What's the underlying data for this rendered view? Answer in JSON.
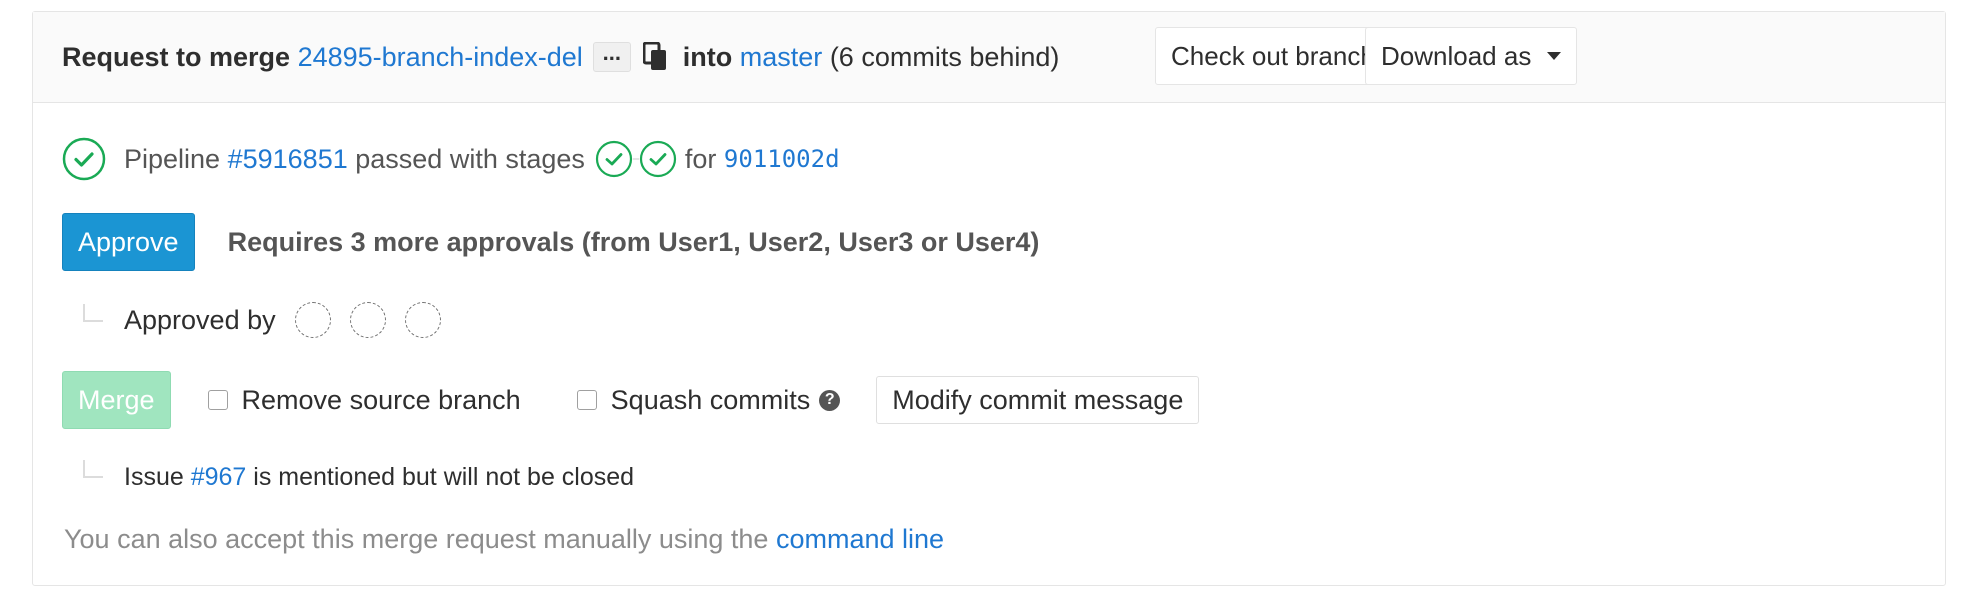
{
  "header": {
    "prefix": "Request to merge",
    "source_branch": "24895-branch-index-del",
    "ellipsis": "...",
    "into": "into",
    "target_branch": "master",
    "behind": "(6 commits behind)",
    "checkout_label": "Check out branch",
    "download_label": "Download as"
  },
  "pipeline": {
    "prefix": "Pipeline",
    "id": "#5916851",
    "status_text": "passed with stages",
    "for_text": "for",
    "commit": "9011002d"
  },
  "approval": {
    "button_label": "Approve",
    "requirement": "Requires 3 more approvals (from User1, User2, User3 or User4)",
    "approved_by": "Approved by"
  },
  "merge": {
    "button_label": "Merge",
    "remove_source": "Remove source branch",
    "squash": "Squash commits",
    "help_glyph": "?",
    "modify_message": "Modify commit message"
  },
  "issue": {
    "prefix": "Issue",
    "id": "#967",
    "suffix": "is mentioned but will not be closed"
  },
  "footer": {
    "text": "You can also accept this merge request manually using the",
    "link": "command line"
  },
  "colors": {
    "link": "#1f78d1",
    "success": "#1aaa55",
    "approve_button": "#1b95d3",
    "merge_button_disabled": "#a0e5bf"
  },
  "icons": [
    "copy-icon",
    "status-success-icon",
    "caret-down-icon",
    "question-circle-icon"
  ]
}
